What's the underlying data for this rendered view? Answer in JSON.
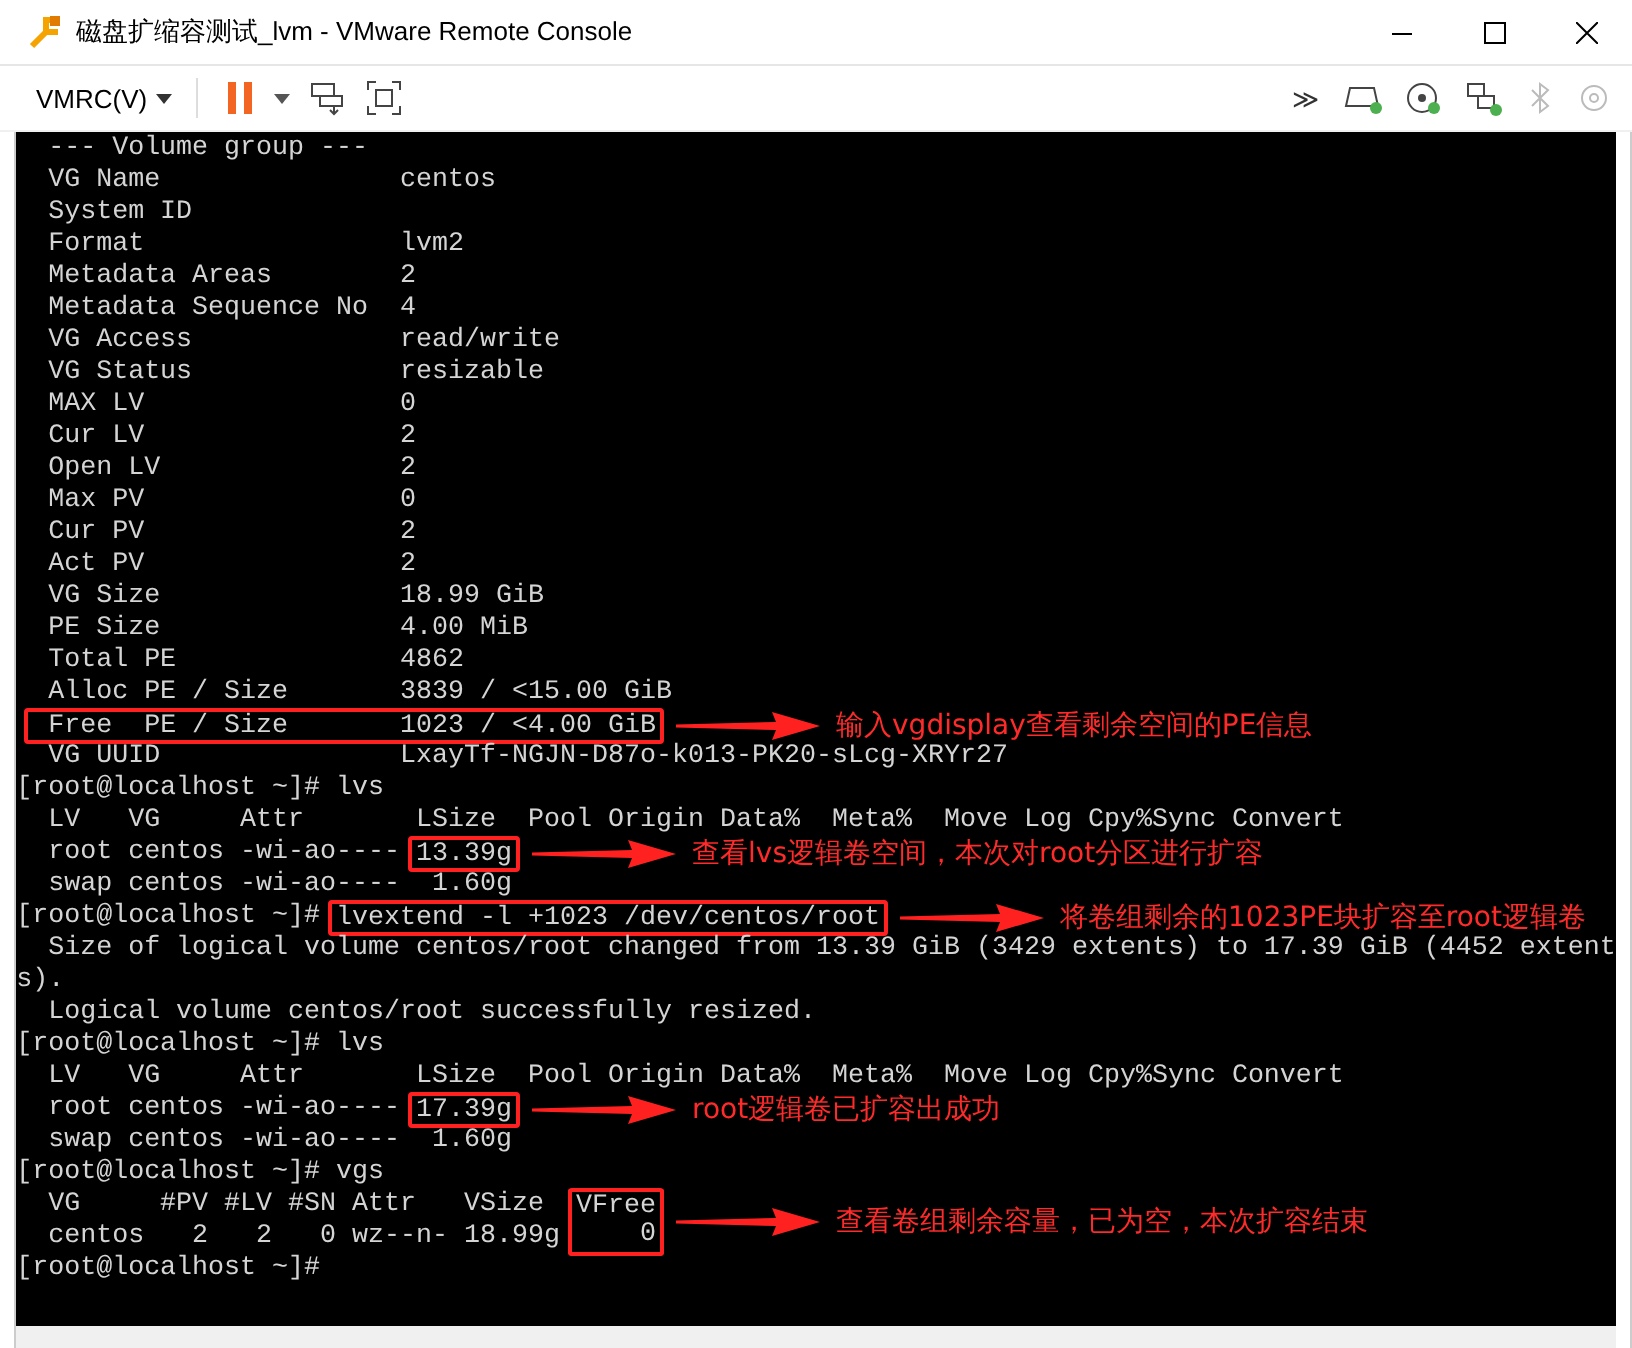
{
  "window": {
    "title": "磁盘扩缩容测试_lvm - VMware Remote Console"
  },
  "toolbar": {
    "menu": "VMRC(V)",
    "more": "≫"
  },
  "terminal": {
    "lines": [
      {
        "text": "  --- Volume group ---"
      },
      {
        "text": "  VG Name               centos"
      },
      {
        "text": "  System ID"
      },
      {
        "text": "  Format                lvm2"
      },
      {
        "text": "  Metadata Areas        2"
      },
      {
        "text": "  Metadata Sequence No  4"
      },
      {
        "text": "  VG Access             read/write"
      },
      {
        "text": "  VG Status             resizable"
      },
      {
        "text": "  MAX LV                0"
      },
      {
        "text": "  Cur LV                2"
      },
      {
        "text": "  Open LV               2"
      },
      {
        "text": "  Max PV                0"
      },
      {
        "text": "  Cur PV                2"
      },
      {
        "text": "  Act PV                2"
      },
      {
        "text": "  VG Size               18.99 GiB"
      },
      {
        "text": "  PE Size               4.00 MiB"
      },
      {
        "text": "  Total PE              4862"
      },
      {
        "text": "  Alloc PE / Size       3839 / <15.00 GiB"
      },
      {
        "segments": [
          {
            "text": " Free  PE / Size       1023 / <4.00 GiB",
            "kind": "boxed"
          }
        ],
        "note": "输入vgdisplay查看剩余空间的PE信息"
      },
      {
        "text": "  VG UUID               LxayTf-NGJN-D87o-k013-PK20-sLcg-XRYr27"
      },
      {
        "text": "[root@localhost ~]# lvs"
      },
      {
        "text": "  LV   VG     Attr       LSize  Pool Origin Data%  Meta%  Move Log Cpy%Sync Convert"
      },
      {
        "segments": [
          {
            "text": "  root centos -wi-ao---- ",
            "kind": "plain"
          },
          {
            "text": "13.39g",
            "kind": "boxed"
          }
        ],
        "note": "查看lvs逻辑卷空间，本次对root分区进行扩容"
      },
      {
        "text": "  swap centos -wi-ao----  1.60g"
      },
      {
        "segments": [
          {
            "text": "[root@localhost ~]# ",
            "kind": "plain"
          },
          {
            "text": "lvextend -l +1023 /dev/centos/root",
            "kind": "boxed"
          }
        ],
        "note": "将卷组剩余的1023PE块扩容至root逻辑卷"
      },
      {
        "text": "  Size of logical volume centos/root changed from 13.39 GiB (3429 extents) to 17.39 GiB (4452 extent"
      },
      {
        "text": "s)."
      },
      {
        "text": "  Logical volume centos/root successfully resized."
      },
      {
        "text": "[root@localhost ~]# lvs"
      },
      {
        "text": "  LV   VG     Attr       LSize  Pool Origin Data%  Meta%  Move Log Cpy%Sync Convert"
      },
      {
        "segments": [
          {
            "text": "  root centos -wi-ao---- ",
            "kind": "plain"
          },
          {
            "text": "17.39g",
            "kind": "boxed"
          }
        ],
        "note": "root逻辑卷已扩容出成功"
      },
      {
        "text": "  swap centos -wi-ao----  1.60g"
      },
      {
        "text": "[root@localhost ~]# vgs"
      },
      {
        "segments": [
          {
            "text": "  VG     #PV #LV #SN Attr   VSize  ",
            "kind": "plain"
          },
          {
            "text": "VFree",
            "kind": "boxed-top"
          }
        ],
        "note": "查看卷组剩余容量，已为空，本次扩容结束"
      },
      {
        "segments": [
          {
            "text": "  centos   2   2   0 wz--n- 18.99g ",
            "kind": "plain"
          },
          {
            "text": "    0",
            "kind": "boxed-bottom"
          }
        ]
      },
      {
        "text": "[root@localhost ~]#"
      }
    ]
  }
}
